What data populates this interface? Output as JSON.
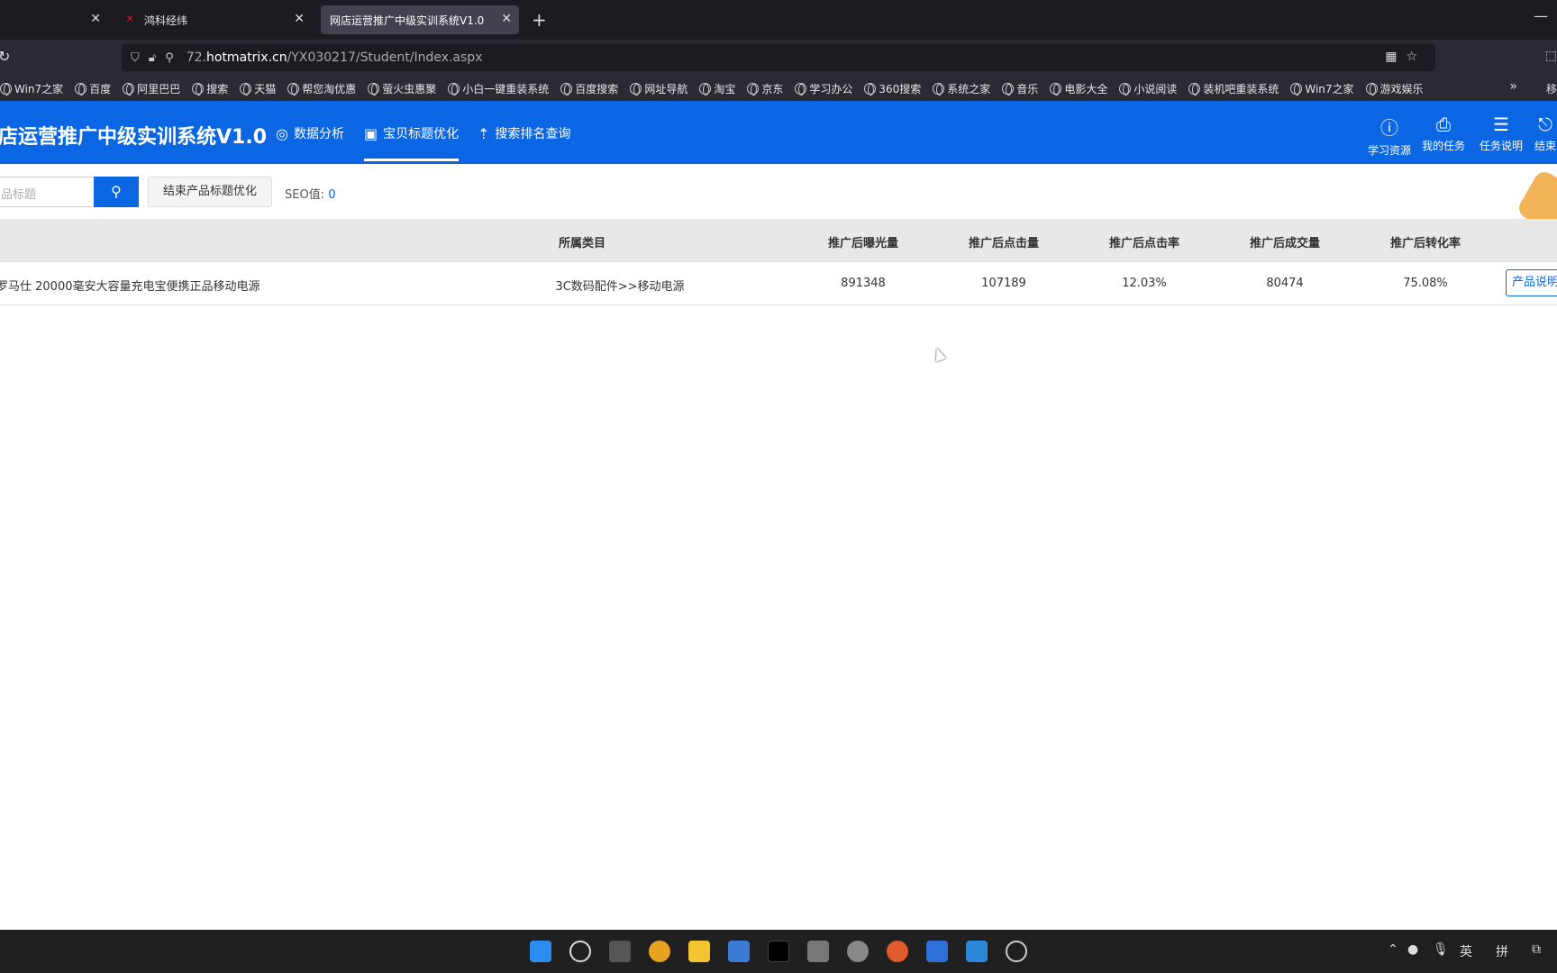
{
  "browser": {
    "tabs": [
      {
        "label": "",
        "active": false
      },
      {
        "label": "鸿科经纬",
        "active": false
      },
      {
        "label": "网店运营推广中级实训系统V1.0",
        "active": true
      }
    ],
    "url_prefix": "72.",
    "url_host": "hotmatrix.cn",
    "url_path": "/YX030217/Student/Index.aspx",
    "bookmarks": [
      "Win7之家",
      "百度",
      "阿里巴巴",
      "搜索",
      "天猫",
      "帮您淘优惠",
      "萤火虫惠聚",
      "小白一键重装系统",
      "百度搜索",
      "网址导航",
      "淘宝",
      "京东",
      "学习办公",
      "360搜索",
      "系统之家",
      "音乐",
      "电影大全",
      "小说阅读",
      "装机吧重装系统",
      "Win7之家",
      "游戏娱乐"
    ],
    "bookmarks_end": "移"
  },
  "app": {
    "title": "店运营推广中级实训系统V1.0",
    "nav": [
      {
        "label": "数据分析",
        "icon": "target-icon"
      },
      {
        "label": "宝贝标题优化",
        "icon": "text-icon",
        "active": true
      },
      {
        "label": "搜索排名查询",
        "icon": "rank-icon"
      }
    ],
    "header_right": [
      {
        "label": "学习资源",
        "icon": "question-icon"
      },
      {
        "label": "我的任务",
        "icon": "bookmark-icon"
      },
      {
        "label": "任务说明",
        "icon": "list-icon"
      },
      {
        "label": "结束",
        "icon": "exit-icon"
      }
    ],
    "accent": "#0b66e4"
  },
  "toolbar": {
    "search_placeholder": "品标题",
    "end_button": "结束产品标题优化",
    "seo_label": "SEO值:",
    "seo_value": "0"
  },
  "table": {
    "headers": [
      "所属类目",
      "推广后曝光量",
      "推广后点击量",
      "推广后点击率",
      "推广后成交量",
      "推广后转化率"
    ],
    "rows": [
      {
        "title": "罗马仕 20000毫安大容量充电宝便携正品移动电源",
        "category": "3C数码配件>>移动电源",
        "exposure": "891348",
        "clicks": "107189",
        "ctr": "12.03%",
        "deals": "80474",
        "conversion": "75.08%",
        "action": "产品说明"
      }
    ]
  },
  "taskbar": {
    "tray": [
      "英",
      "拼"
    ]
  }
}
